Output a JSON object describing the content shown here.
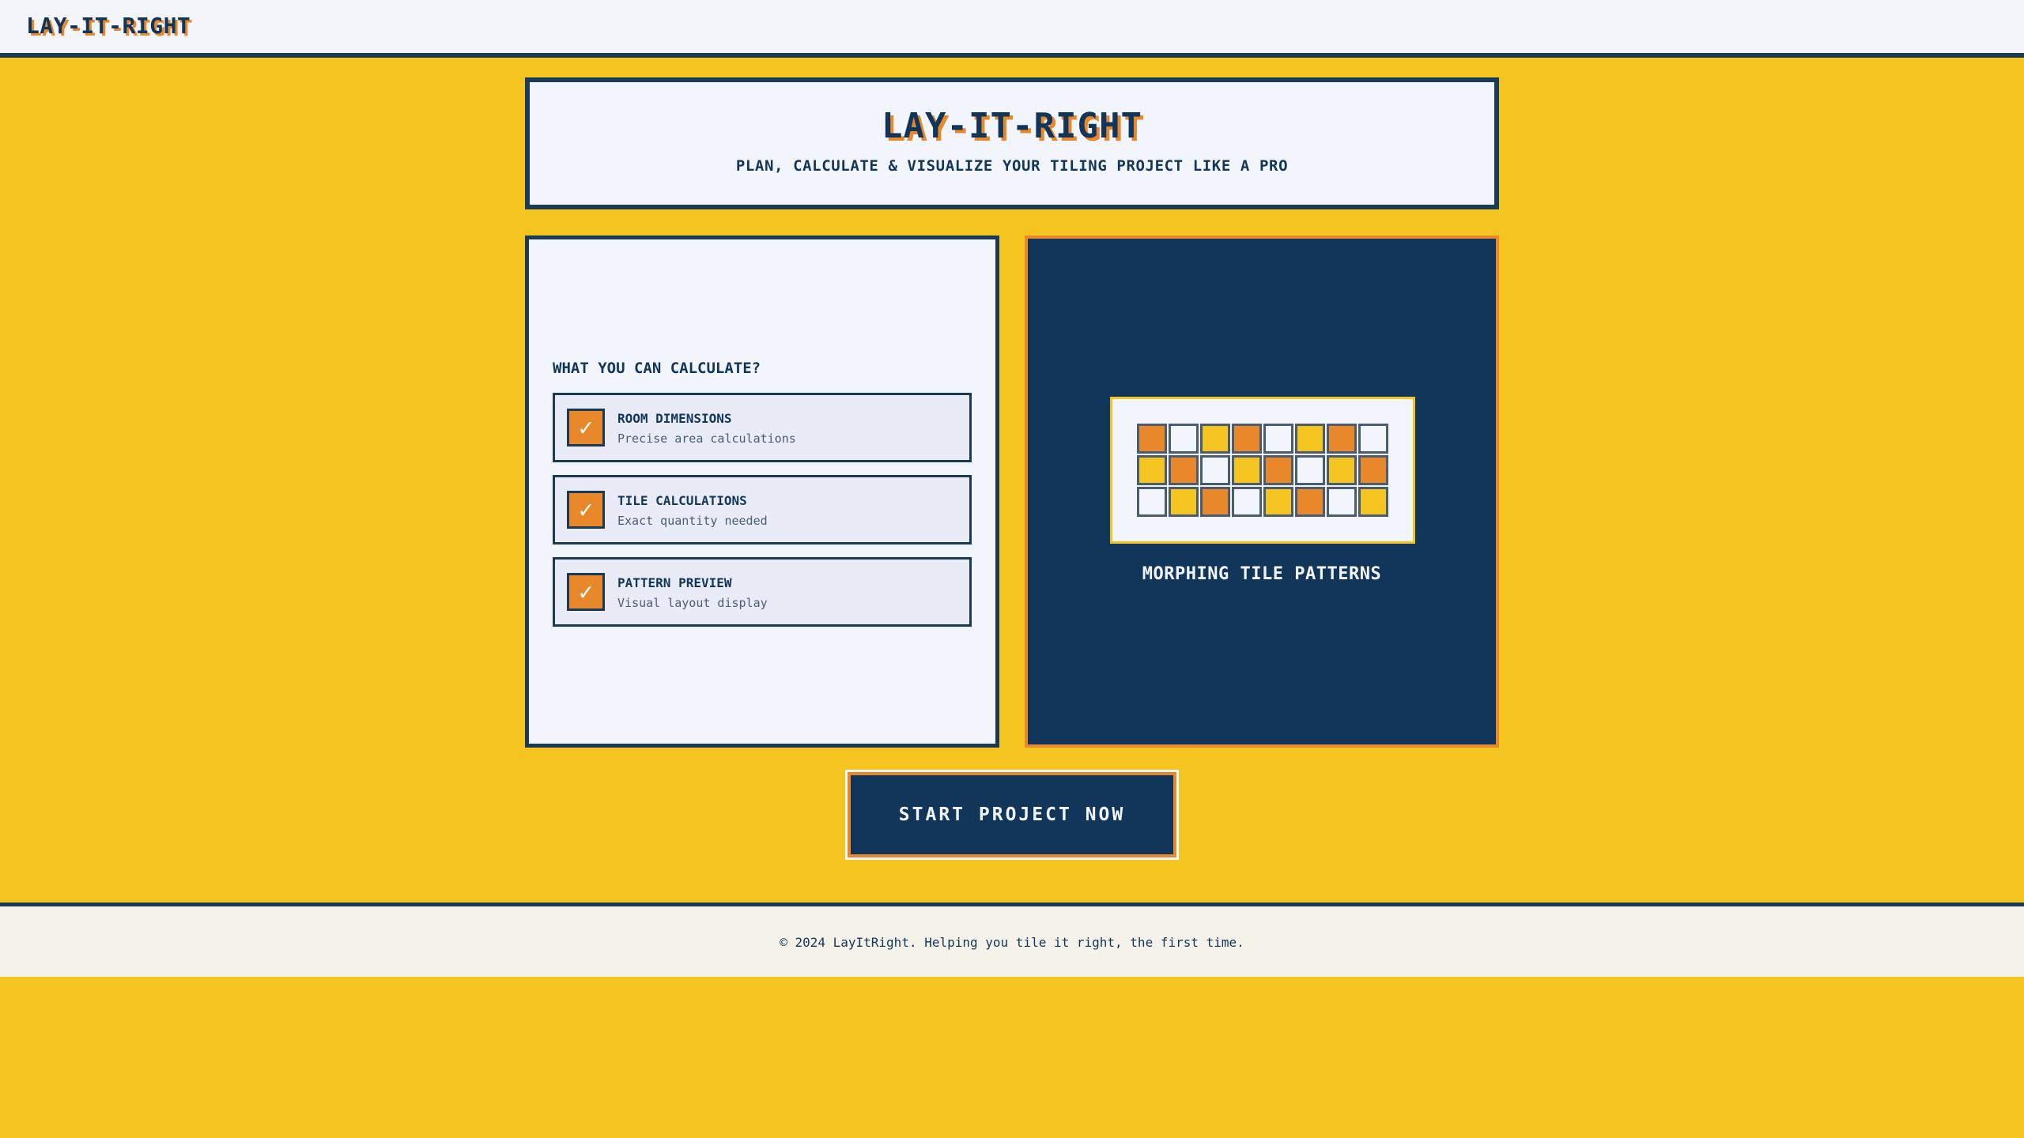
{
  "header": {
    "brand": "LAY-IT-RIGHT"
  },
  "hero": {
    "title": "LAY-IT-RIGHT",
    "subtitle": "PLAN, CALCULATE & VISUALIZE YOUR TILING PROJECT LIKE A PRO"
  },
  "features": {
    "heading": "WHAT YOU CAN CALCULATE?",
    "check_glyph": "✓",
    "items": [
      {
        "title": "ROOM DIMENSIONS",
        "desc": "Precise area calculations"
      },
      {
        "title": "TILE CALCULATIONS",
        "desc": "Exact quantity needed"
      },
      {
        "title": "PATTERN PREVIEW",
        "desc": "Visual layout display"
      }
    ]
  },
  "pattern": {
    "caption": "MORPHING TILE PATTERNS",
    "colors": {
      "orange": "#e9882b",
      "yellow": "#f4c520",
      "white": "#f3f5fd"
    },
    "rows": [
      [
        "orange",
        "white",
        "yellow",
        "orange",
        "white",
        "yellow",
        "orange",
        "white"
      ],
      [
        "yellow",
        "orange",
        "white",
        "yellow",
        "orange",
        "white",
        "yellow",
        "orange"
      ],
      [
        "white",
        "yellow",
        "orange",
        "white",
        "yellow",
        "orange",
        "white",
        "yellow"
      ]
    ]
  },
  "cta": {
    "label": "START PROJECT NOW"
  },
  "footer": {
    "text": "© 2024 LayItRight. Helping you tile it right, the first time."
  }
}
